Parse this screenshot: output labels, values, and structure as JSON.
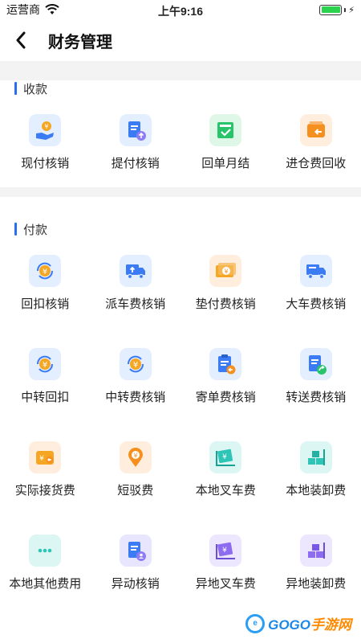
{
  "status_bar": {
    "carrier": "运营商",
    "time": "上午9:16",
    "battery_level": 1.0
  },
  "nav": {
    "title": "财务管理",
    "back_icon": "chevron-left-icon"
  },
  "sections": [
    {
      "title": "收款",
      "items": [
        {
          "label": "现付核销",
          "icon": "hand-coin-icon",
          "bg": "#e3efff"
        },
        {
          "label": "提付核销",
          "icon": "doc-upload-icon",
          "bg": "#e3efff"
        },
        {
          "label": "回单月结",
          "icon": "receipt-check-icon",
          "bg": "#dff7e6"
        },
        {
          "label": "进仓费回收",
          "icon": "wallet-return-icon",
          "bg": "#ffeede"
        }
      ]
    },
    {
      "title": "付款",
      "items": [
        {
          "label": "回扣核销",
          "icon": "coin-cycle-icon",
          "bg": "#e3efff"
        },
        {
          "label": "派车费核销",
          "icon": "truck-up-icon",
          "bg": "#e3efff"
        },
        {
          "label": "垫付费核销",
          "icon": "bills-icon",
          "bg": "#ffeede"
        },
        {
          "label": "大车费核销",
          "icon": "truck-icon",
          "bg": "#e3efff"
        },
        {
          "label": "中转回扣",
          "icon": "coin-cycle-icon",
          "bg": "#e3efff"
        },
        {
          "label": "中转费核销",
          "icon": "coin-cycle-icon",
          "bg": "#e3efff"
        },
        {
          "label": "寄单费核销",
          "icon": "clipboard-send-icon",
          "bg": "#e3efff"
        },
        {
          "label": "转送费核销",
          "icon": "doc-forward-icon",
          "bg": "#e3efff"
        },
        {
          "label": "实际接货费",
          "icon": "wallet-receive-icon",
          "bg": "#ffeede"
        },
        {
          "label": "短驳费",
          "icon": "location-coin-icon",
          "bg": "#ffeede"
        },
        {
          "label": "本地叉车费",
          "icon": "forklift-coin-icon",
          "bg": "#dcf6f4"
        },
        {
          "label": "本地装卸费",
          "icon": "boxes-icon",
          "bg": "#dcf6f4"
        },
        {
          "label": "本地其他费用",
          "icon": "more-dots-icon",
          "bg": "#dcf6f4"
        },
        {
          "label": "异动核销",
          "icon": "doc-user-icon",
          "bg": "#e8e6ff"
        },
        {
          "label": "异地叉车费",
          "icon": "forklift-coin-icon",
          "bg": "#ece6ff"
        },
        {
          "label": "异地装卸费",
          "icon": "boxes-icon",
          "bg": "#ece6ff"
        }
      ]
    }
  ],
  "watermark": {
    "brand_blue": "GOGO",
    "brand_orange": "手游网",
    "badge": "e"
  }
}
